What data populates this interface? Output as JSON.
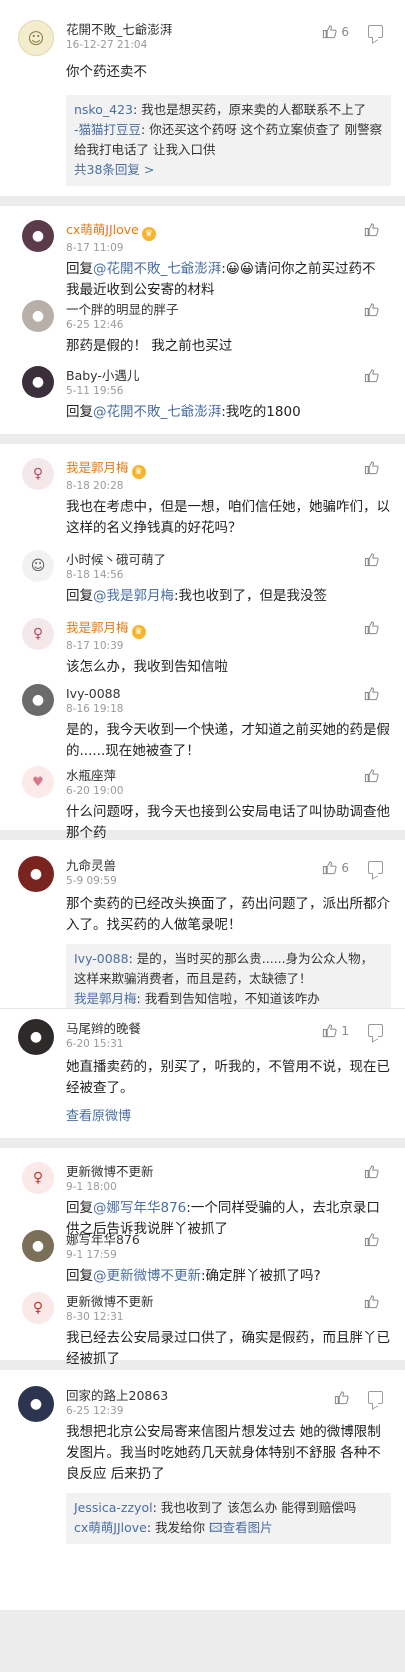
{
  "comments": [
    {
      "name": "花開不敗_七爺澎湃",
      "time": "16-12-27 21:04",
      "likes": "6",
      "text": "你个药还卖不",
      "replies": [
        {
          "name": "nsko_423",
          "text": ": 我也是想买药，原来卖的人都联系不上了"
        },
        {
          "name": "-猫猫打豆豆",
          "text": ": 你还买这个药呀 这个药立案侦查了 刚警察给我打电话了 让我入口供"
        }
      ],
      "more": "共38条回复 >"
    },
    {
      "name": "cx萌萌JJlove",
      "time": "8-17 11:09",
      "reply_prefix": "回复",
      "reply_to": "@花開不敗_七爺澎湃",
      "text": ":😀😀请问你之前买过药不 我最近收到公安寄的材料"
    },
    {
      "name": "一个胖的明显的胖子",
      "time": "6-25 12:46",
      "text": "那药是假的！ 我之前也买过"
    },
    {
      "name": "Baby-小遇儿",
      "time": "5-11 19:56",
      "reply_prefix": "回复",
      "reply_to": "@花開不敗_七爺澎湃",
      "text": ":我吃的1800"
    },
    {
      "name": "我是郭月梅",
      "time": "8-18 20:28",
      "text": "我也在考虑中，但是一想，咱们信任她，她骗咋们，以这样的名义挣钱真的好花吗？"
    },
    {
      "name": "小时候丶硪可萌了",
      "time": "8-18 14:56",
      "reply_prefix": "回复",
      "reply_to": "@我是郭月梅",
      "text": ":我也收到了，但是我没签"
    },
    {
      "name": "我是郭月梅",
      "time": "8-17 10:39",
      "text": "该怎么办，我收到告知信啦"
    },
    {
      "name": "Ivy-0088",
      "time": "8-16 19:18",
      "text": "是的，我今天收到一个快递，才知道之前买她的药是假的......现在她被查了！"
    },
    {
      "name": "水瓶座萍",
      "time": "6-20 19:00",
      "text": "什么问题呀，我今天也接到公安局电话了叫协助调查他那个药"
    },
    {
      "name": "九命灵兽",
      "time": "5-9 09:59",
      "likes": "6",
      "text": "那个卖药的已经改头换面了，药出问题了，派出所都介入了。找买药的人做笔录呢！",
      "replies": [
        {
          "name": "Ivy-0088",
          "text": ": 是的，当时买的那么贵......身为公众人物，这样来欺骗消费者，而且是药，太缺德了！"
        },
        {
          "name": "我是郭月梅",
          "text": ": 我看到告知信啦，不知道该咋办"
        }
      ]
    },
    {
      "name": "马尾辫的晚餐",
      "time": "6-20 15:31",
      "likes": "1",
      "text": "她直播卖药的，别买了，听我的，不管用不说，现在已经被查了。",
      "view_original": "查看原微博"
    },
    {
      "name": "更新微博不更新",
      "time": "9-1 18:00",
      "reply_prefix": "回复",
      "reply_to": "@娜写年华876",
      "text": ":一个同样受骗的人，去北京录口供之后告诉我说胖丫被抓了"
    },
    {
      "name": "娜写年华876",
      "time": "9-1 17:59",
      "reply_prefix": "回复",
      "reply_to": "@更新微博不更新",
      "text": ":确定胖丫被抓了吗?"
    },
    {
      "name": "更新微博不更新",
      "time": "8-30 12:31",
      "text": "我已经去公安局录过口供了，确实是假药，而且胖丫已经被抓了"
    },
    {
      "name": "回家的路上20863",
      "time": "6-25 12:39",
      "text": "我想把北京公安局寄来信图片想发过去 她的微博限制发图片。我当时吃她药几天就身体特别不舒服 各种不良反应 后来扔了",
      "replies": [
        {
          "name": "Jessica-zzyol",
          "text": ": 我也收到了 该怎么办 能得到赔偿吗"
        },
        {
          "name": "cx萌萌JJlove",
          "text": ": 我发给你 ",
          "link": "查看图片"
        }
      ]
    }
  ],
  "colors": {
    "link": "#4a6fa5",
    "orange_name": "#e87b10",
    "background": "#ececec"
  }
}
